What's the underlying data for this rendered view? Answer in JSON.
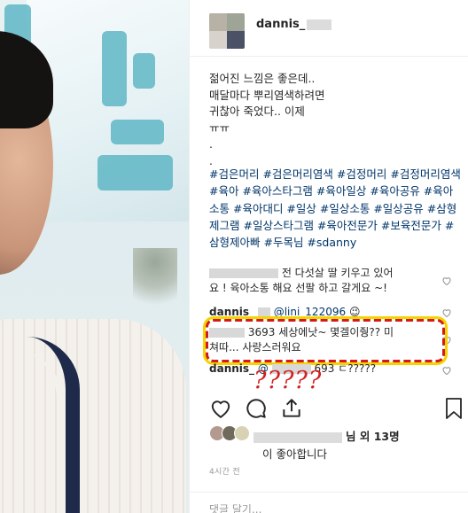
{
  "post": {
    "username": "dannis_",
    "caption_lines": [
      "젊어진 느낌은 좋은데..",
      "매달마다 뿌리염색하려면",
      "귀찮아 죽었다.. 이제",
      "ㅠㅠ",
      ".",
      "."
    ],
    "hashtags": "#검은머리 #검은머리염색 #검정머리 #검정머리염색 #육아 #육아스타그램 #육아일상 #육아공유 #육아소통 #육아대디 #일상 #일상소통 #일상공유 #삼형제그램 #일상스타그램 #육아전문가 #보육전문가 #삼형제아빠 #두목님 #sdanny"
  },
  "comments": [
    {
      "user": "lini_122096",
      "text_a": "전 다섯살 딸 키우고 있어",
      "text_b": "요 ! 육아소통 해요 선팔 하고 갈게요 ~!"
    },
    {
      "user": "dannis_",
      "mention": "@lini_122096",
      "emoji": "😉"
    },
    {
      "user": "3693",
      "text_a": "세상에낫~ 몇겔이줭?? 미",
      "text_b": "쳐따... 사랑스러워요"
    },
    {
      "user": "dannis_",
      "mention": "@",
      "tail": "693 ㄷ?????"
    }
  ],
  "annotation": {
    "question_marks": "?????"
  },
  "likes": {
    "text_suffix": "님 외 13명",
    "text_line2": "이 좋아합니다"
  },
  "timestamp": "4시간 전",
  "add_comment_placeholder": "댓글 달기...",
  "icons": [
    "heart-icon",
    "comment-icon",
    "share-icon",
    "bookmark-icon"
  ],
  "colors": {
    "hashtag": "#003569",
    "annotation_red": "#d11a1a",
    "annotation_yellow": "#f4d300"
  }
}
